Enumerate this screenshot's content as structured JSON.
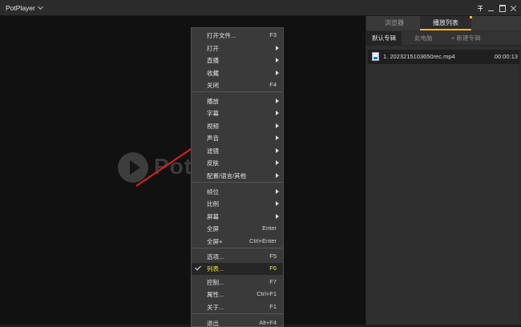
{
  "app": {
    "title": "PotPlayer"
  },
  "window_controls": [
    "pin-icon",
    "minimize-icon",
    "maximize-icon",
    "close-icon"
  ],
  "video": {
    "logo_text": "Pot"
  },
  "context_menu": {
    "items": [
      {
        "label": "打开文件...",
        "shortcut": "F3",
        "submenu": false,
        "checked": false,
        "active": false
      },
      {
        "label": "打开",
        "shortcut": "",
        "submenu": true,
        "checked": false,
        "active": false
      },
      {
        "label": "直播",
        "shortcut": "",
        "submenu": true,
        "checked": false,
        "active": false
      },
      {
        "label": "收藏",
        "shortcut": "",
        "submenu": true,
        "checked": false,
        "active": false
      },
      {
        "label": "关闭",
        "shortcut": "F4",
        "submenu": false,
        "checked": false,
        "active": false
      },
      {
        "label": "播放",
        "shortcut": "",
        "submenu": true,
        "checked": false,
        "active": false
      },
      {
        "label": "字幕",
        "shortcut": "",
        "submenu": true,
        "checked": false,
        "active": false
      },
      {
        "label": "视频",
        "shortcut": "",
        "submenu": true,
        "checked": false,
        "active": false
      },
      {
        "label": "声音",
        "shortcut": "",
        "submenu": true,
        "checked": false,
        "active": false
      },
      {
        "label": "滤镜",
        "shortcut": "",
        "submenu": true,
        "checked": false,
        "active": false
      },
      {
        "label": "皮肤",
        "shortcut": "",
        "submenu": true,
        "checked": false,
        "active": false
      },
      {
        "label": "配置/语言/其他",
        "shortcut": "",
        "submenu": true,
        "checked": false,
        "active": false
      },
      {
        "label": "帧位",
        "shortcut": "",
        "submenu": true,
        "checked": false,
        "active": false
      },
      {
        "label": "比例",
        "shortcut": "",
        "submenu": true,
        "checked": false,
        "active": false
      },
      {
        "label": "屏幕",
        "shortcut": "",
        "submenu": true,
        "checked": false,
        "active": false
      },
      {
        "label": "全屏",
        "shortcut": "Enter",
        "submenu": false,
        "checked": false,
        "active": false
      },
      {
        "label": "全屏+",
        "shortcut": "Ctrl+Enter",
        "submenu": false,
        "checked": false,
        "active": false
      },
      {
        "label": "选项...",
        "shortcut": "F5",
        "submenu": false,
        "checked": false,
        "active": false
      },
      {
        "label": "列表...",
        "shortcut": "F6",
        "submenu": false,
        "checked": true,
        "active": true
      },
      {
        "label": "控制...",
        "shortcut": "F7",
        "submenu": false,
        "checked": false,
        "active": false
      },
      {
        "label": "属性...",
        "shortcut": "Ctrl+F1",
        "submenu": false,
        "checked": false,
        "active": false
      },
      {
        "label": "关于...",
        "shortcut": "F1",
        "submenu": false,
        "checked": false,
        "active": false
      },
      {
        "label": "退出",
        "shortcut": "Alt+F4",
        "submenu": false,
        "checked": false,
        "active": false
      }
    ]
  },
  "panel": {
    "tabs": [
      {
        "label": "浏览器",
        "active": false
      },
      {
        "label": "播放列表",
        "active": true
      }
    ],
    "subtabs": [
      {
        "label": "默认专辑",
        "active": true
      },
      {
        "label": "此电脑",
        "active": false
      },
      {
        "label": "+ 新建专辑",
        "active": false
      }
    ],
    "playlist": [
      {
        "name": "1. 2023215103650rec.mp4",
        "duration": "00:00:13"
      }
    ]
  },
  "colors": {
    "accent": "#f0c000",
    "highlight_text": "#f0e040",
    "annotation_arrow": "#d42020"
  }
}
